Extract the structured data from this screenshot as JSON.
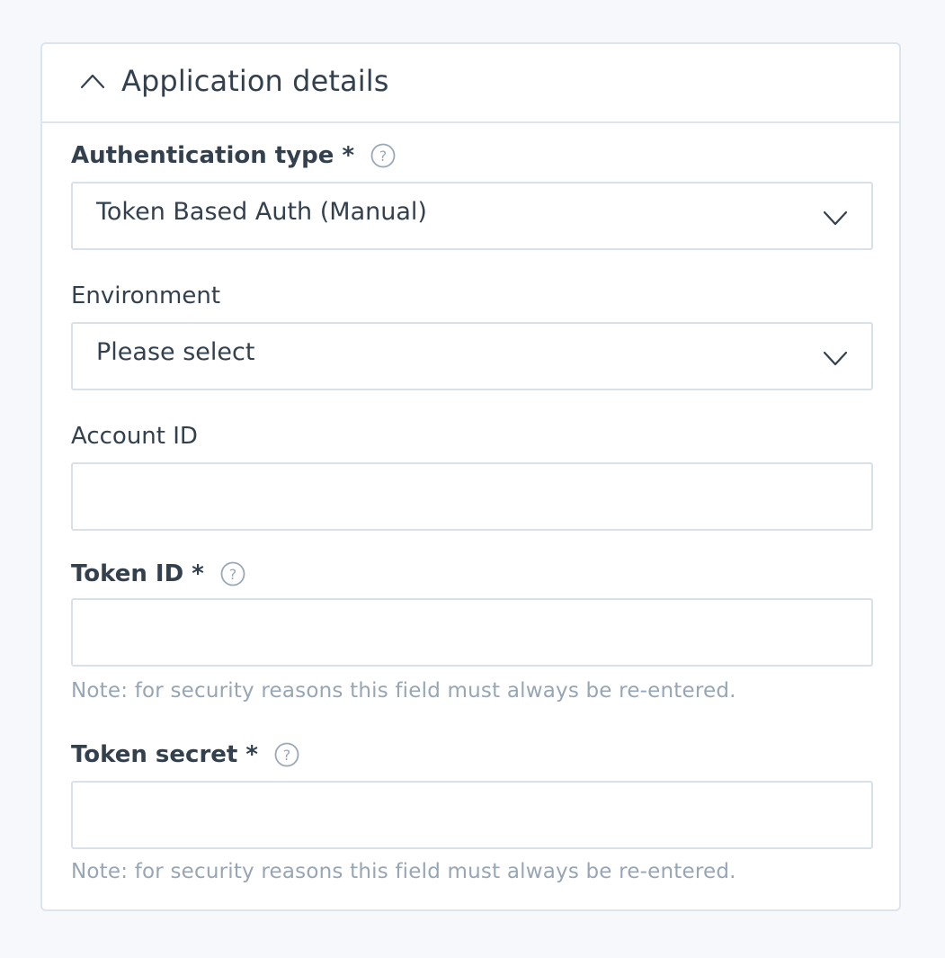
{
  "section": {
    "title": "Application details",
    "toggle_icon": "chevron-up-icon"
  },
  "fields": {
    "auth_type": {
      "label": "Authentication type *",
      "value": "Token Based Auth (Manual)",
      "help_icon": "question-circle-icon"
    },
    "environment": {
      "label": "Environment",
      "value": "Please select"
    },
    "account_id": {
      "label": "Account ID",
      "value": ""
    },
    "token_id": {
      "label": "Token ID *",
      "value": "",
      "help_icon": "question-circle-icon",
      "note": "Note: for security reasons this field must always be re-entered."
    },
    "token_secret": {
      "label": "Token secret *",
      "value": "",
      "help_icon": "question-circle-icon",
      "note": "Note: for security reasons this field must always be re-entered."
    }
  },
  "colors": {
    "background": "#f6f8fc",
    "card_border": "#dde4ec",
    "text": "#33414f",
    "note_text": "#97a6b5",
    "help_icon": "#9aa8b8"
  }
}
